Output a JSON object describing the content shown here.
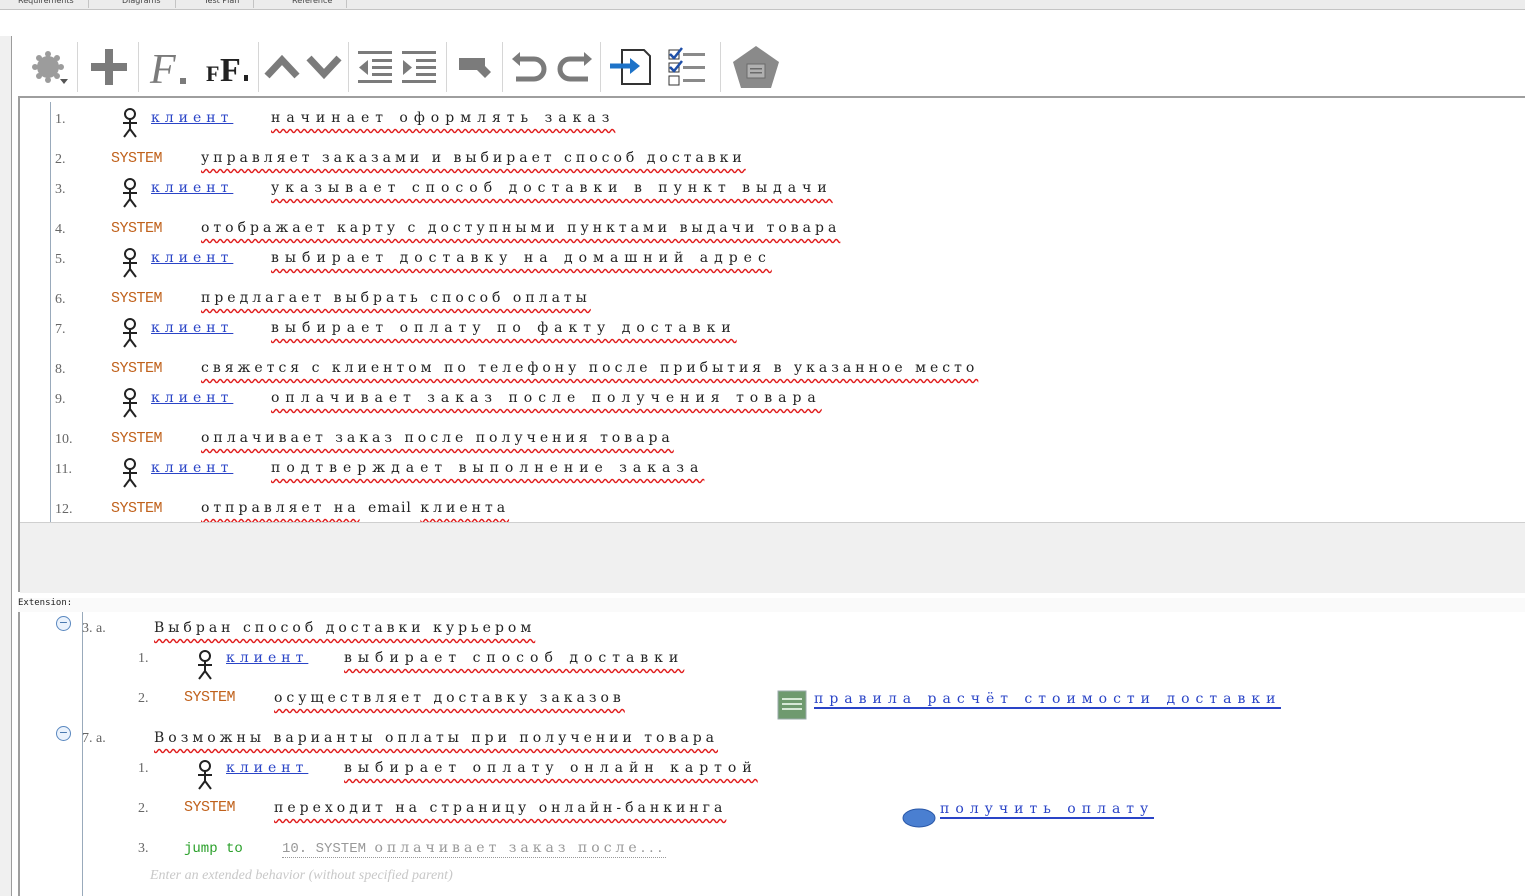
{
  "tabs": [
    "Requirements",
    "Diagrams",
    "Test Plan",
    "Reference"
  ],
  "toolbar": {
    "buttons": [
      "settings-icon",
      "add-icon",
      "italic-f-icon",
      "bold-ff-icon",
      "arrow-up-icon",
      "arrow-down-icon",
      "outdent-icon",
      "indent-icon",
      "link-icon",
      "undo-icon",
      "redo-icon",
      "insert-icon",
      "checklist-icon",
      "pentagon-icon"
    ]
  },
  "main_steps": [
    {
      "num": "1.",
      "kind": "actor",
      "actor": "клиент",
      "text": "начинает оформлять заказ"
    },
    {
      "num": "2.",
      "kind": "system",
      "system": "SYSTEM",
      "text": "управляет заказами и выбирает способ доставки"
    },
    {
      "num": "3.",
      "kind": "actor",
      "actor": "клиент",
      "text": "указывает способ доставки в пункт выдачи"
    },
    {
      "num": "4.",
      "kind": "system",
      "system": "SYSTEM",
      "text": "отображает карту с доступными пунктами выдачи товара"
    },
    {
      "num": "5.",
      "kind": "actor",
      "actor": "клиент",
      "text": "выбирает доставку на домашний адрес"
    },
    {
      "num": "6.",
      "kind": "system",
      "system": "SYSTEM",
      "text": "предлагает выбрать способ оплаты"
    },
    {
      "num": "7.",
      "kind": "actor",
      "actor": "клиент",
      "text": "выбирает оплату по факту доставки"
    },
    {
      "num": "8.",
      "kind": "system",
      "system": "SYSTEM",
      "text": "свяжется с клиентом по телефону после прибытия в указанное место"
    },
    {
      "num": "9.",
      "kind": "actor",
      "actor": "клиент",
      "text": "оплачивает заказ после получения товара"
    },
    {
      "num": "10.",
      "kind": "system",
      "system": "SYSTEM",
      "text": "оплачивает заказ после получения товара"
    },
    {
      "num": "11.",
      "kind": "actor",
      "actor": "клиент",
      "text": "подтверждает выполнение заказа"
    },
    {
      "num": "12.",
      "kind": "system",
      "system": "SYSTEM",
      "text_a": "отправляет на",
      "text_b": "email",
      "text_c": "клиента"
    }
  ],
  "extension": {
    "label": "Extension:",
    "groups": [
      {
        "num": "3. a.",
        "title": "Выбран способ доставки курьером",
        "steps": [
          {
            "num": "1.",
            "actor": "клиент",
            "text": "выбирает способ доставки"
          },
          {
            "num": "2.",
            "system": "SYSTEM",
            "text": "осуществляет доставку заказов",
            "include": "правила расчёт стоимости доставки"
          }
        ]
      },
      {
        "num": "7. a.",
        "title": "Возможны варианты оплаты при получении товара",
        "steps": [
          {
            "num": "1.",
            "actor": "клиент",
            "text": "выбирает оплату онлайн картой"
          },
          {
            "num": "2.",
            "system": "SYSTEM",
            "text": "переходит на страницу онлайн-банкинга",
            "include": "получить оплату"
          },
          {
            "num": "3.",
            "jump": "jump to",
            "target_num": "10. SYSTEM",
            "target_text": "оплачивает заказ после..."
          }
        ]
      }
    ],
    "placeholder": "Enter an extended behavior (without specified parent)"
  }
}
